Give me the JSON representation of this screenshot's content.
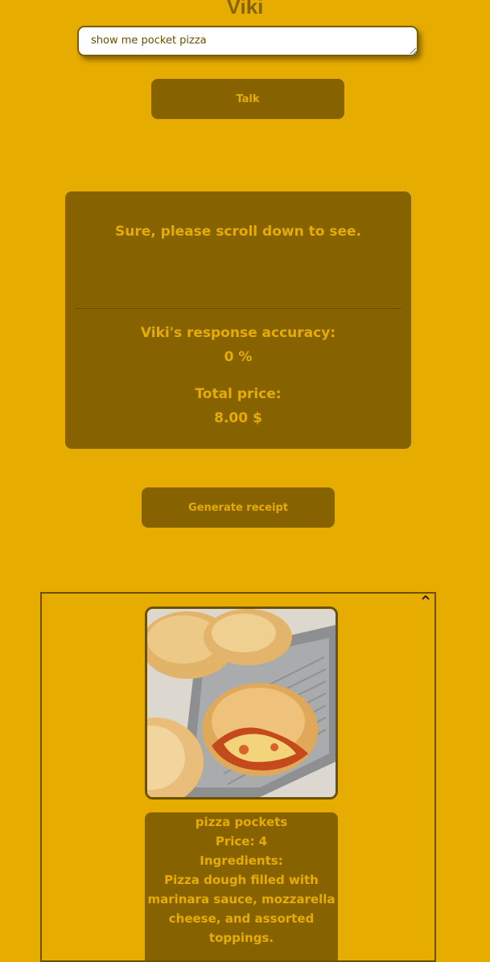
{
  "app": {
    "title": "Viki"
  },
  "chat": {
    "input_value": "show me pocket pizza",
    "talk_label": "Talk"
  },
  "response": {
    "message": "Sure, please scroll down to see.",
    "accuracy_label": "Viki's response accuracy:",
    "accuracy_value": "0 %",
    "total_price_label": "Total price:",
    "total_price_value": "8.00 $"
  },
  "receipt": {
    "button_label": "Generate receipt"
  },
  "results": {
    "scroll_icon": "chevron-up-icon",
    "product": {
      "name": "pizza pockets",
      "price": "Price: 4",
      "ingredients_label": "Ingredients:",
      "ingredients_text": "Pizza dough filled with marinara sauce, mozzarella cheese, and assorted toppings."
    }
  },
  "colors": {
    "background": "#e6ac00",
    "panel": "#876300",
    "accent_text": "#e6ac00"
  }
}
